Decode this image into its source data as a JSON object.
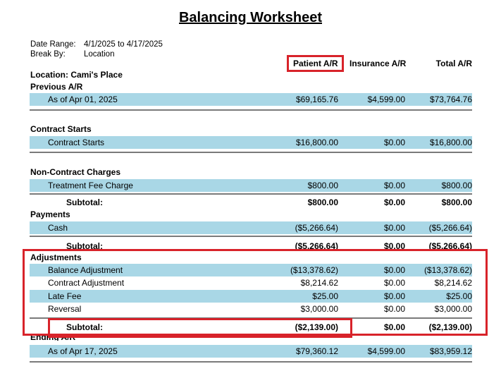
{
  "title": "Balancing Worksheet",
  "meta": {
    "date_range_label": "Date Range:",
    "date_range_value": "4/1/2025 to 4/17/2025",
    "break_by_label": "Break By:",
    "break_by_value": "Location"
  },
  "columns": [
    "Patient A/R",
    "Insurance A/R",
    "Total A/R"
  ],
  "location": "Location: Cami's Place",
  "sections": {
    "previous": {
      "title": "Previous A/R",
      "rows": [
        {
          "label": "As of Apr 01, 2025",
          "patient": "$69,165.76",
          "insurance": "$4,599.00",
          "total": "$73,764.76"
        }
      ]
    },
    "contract_starts": {
      "title": "Contract Starts",
      "rows": [
        {
          "label": "Contract Starts",
          "patient": "$16,800.00",
          "insurance": "$0.00",
          "total": "$16,800.00"
        }
      ]
    },
    "non_contract": {
      "title": "Non-Contract Charges",
      "rows": [
        {
          "label": "Treatment Fee Charge",
          "patient": "$800.00",
          "insurance": "$0.00",
          "total": "$800.00"
        }
      ],
      "subtotal": {
        "label": "Subtotal:",
        "patient": "$800.00",
        "insurance": "$0.00",
        "total": "$800.00"
      }
    },
    "payments": {
      "title": "Payments",
      "rows": [
        {
          "label": "Cash",
          "patient": "($5,266.64)",
          "insurance": "$0.00",
          "total": "($5,266.64)"
        }
      ],
      "subtotal": {
        "label": "Subtotal:",
        "patient": "($5,266.64)",
        "insurance": "$0.00",
        "total": "($5,266.64)"
      }
    },
    "adjustments": {
      "title": "Adjustments",
      "rows": [
        {
          "label": "Balance Adjustment",
          "patient": "($13,378.62)",
          "insurance": "$0.00",
          "total": "($13,378.62)"
        },
        {
          "label": "Contract Adjustment",
          "patient": "$8,214.62",
          "insurance": "$0.00",
          "total": "$8,214.62"
        },
        {
          "label": "Late Fee",
          "patient": "$25.00",
          "insurance": "$0.00",
          "total": "$25.00"
        },
        {
          "label": "Reversal",
          "patient": "$3,000.00",
          "insurance": "$0.00",
          "total": "$3,000.00"
        }
      ],
      "subtotal": {
        "label": "Subtotal:",
        "patient": "($2,139.00)",
        "insurance": "$0.00",
        "total": "($2,139.00)"
      }
    },
    "ending": {
      "title": "Ending A/R",
      "rows": [
        {
          "label": "As of Apr 17, 2025",
          "patient": "$79,360.12",
          "insurance": "$4,599.00",
          "total": "$83,959.12"
        }
      ]
    }
  },
  "highlight_color": "#d8232a",
  "band_color": "#a9d7e6"
}
